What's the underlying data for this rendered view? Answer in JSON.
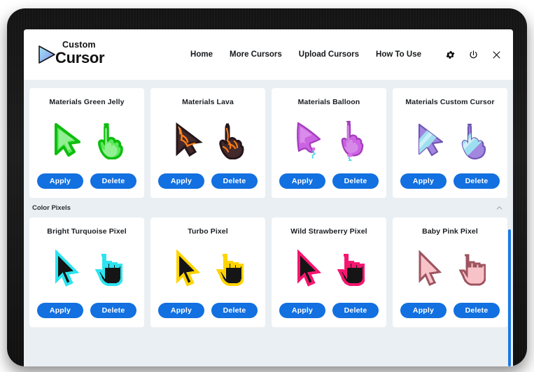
{
  "app": {
    "logo_top": "Custom",
    "logo_bottom": "Cursor",
    "logo_icon": "cursor-arrow-logo"
  },
  "nav": {
    "links": [
      {
        "label": "Home",
        "name": "nav-home"
      },
      {
        "label": "More Cursors",
        "name": "nav-more-cursors"
      },
      {
        "label": "Upload Cursors",
        "name": "nav-upload-cursors"
      },
      {
        "label": "How To Use",
        "name": "nav-how-to-use"
      }
    ],
    "icons": [
      {
        "name": "gear-icon",
        "label": "settings"
      },
      {
        "name": "power-icon",
        "label": "power"
      },
      {
        "name": "close-icon",
        "label": "close"
      }
    ]
  },
  "buttons": {
    "apply": "Apply",
    "delete": "Delete"
  },
  "sections": [
    {
      "id": "materials",
      "title": "",
      "cards": [
        {
          "title": "Materials Green Jelly",
          "style": "jelly",
          "fill": "#4ee24e",
          "fill2": "#9bf59b",
          "stroke": "#14c414"
        },
        {
          "title": "Materials Lava",
          "style": "lava",
          "fill": "#4a3438",
          "fill2": "#6b4a44",
          "stroke": "#2a1c1e"
        },
        {
          "title": "Materials Balloon",
          "style": "balloon",
          "fill": "#c85fe0",
          "fill2": "#dd92ee",
          "stroke": "#a13cbb"
        },
        {
          "title": "Materials Custom Cursor",
          "style": "stripe",
          "fill": "#9a7fd8",
          "fill2": "#b9a4e8",
          "stroke": "#7059b5"
        }
      ]
    },
    {
      "id": "color-pixels",
      "title": "Color Pixels",
      "collapse_icon": "chevron-up-icon",
      "cards": [
        {
          "title": "Bright Turquoise Pixel",
          "style": "pixel",
          "fill": "#151515",
          "stroke": "#2ce4f0"
        },
        {
          "title": "Turbo Pixel",
          "style": "pixel",
          "fill": "#151515",
          "stroke": "#ffd400"
        },
        {
          "title": "Wild Strawberry Pixel",
          "style": "pixel",
          "fill": "#151515",
          "stroke": "#f6166f"
        },
        {
          "title": "Baby Pink Pixel",
          "style": "pixel",
          "fill": "#f8c3c8",
          "stroke": "#9e5560"
        }
      ]
    }
  ],
  "scrollbar": {
    "color": "#1a7ae8"
  }
}
